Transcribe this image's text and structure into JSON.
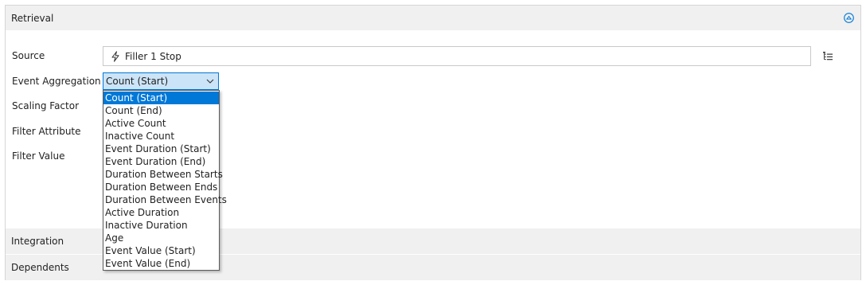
{
  "sections": {
    "retrieval": "Retrieval",
    "integration": "Integration",
    "dependents": "Dependents"
  },
  "icons": {
    "collapse": "collapse-up-circle-icon",
    "source": "lightning-bolt-icon",
    "tree": "tree-list-icon",
    "dropdown": "chevron-down-icon"
  },
  "fields": {
    "source_label": "Source",
    "source_value": "Filler 1 Stop",
    "aggregation_label": "Event Aggregation",
    "aggregation_value": "Count (Start)",
    "scaling_label": "Scaling Factor",
    "filter_attribute_label": "Filter Attribute",
    "filter_value_label": "Filter Value"
  },
  "aggregation_options": [
    "Count (Start)",
    "Count (End)",
    "Active Count",
    "Inactive Count",
    "Event Duration (Start)",
    "Event Duration (End)",
    "Duration Between Starts",
    "Duration Between Ends",
    "Duration Between Events",
    "Active Duration",
    "Inactive Duration",
    "Age",
    "Event Value (Start)",
    "Event Value (End)"
  ],
  "colors": {
    "accent": "#0078d7",
    "select_bg": "#cce4f7",
    "header_bg": "#f0f0f0"
  }
}
